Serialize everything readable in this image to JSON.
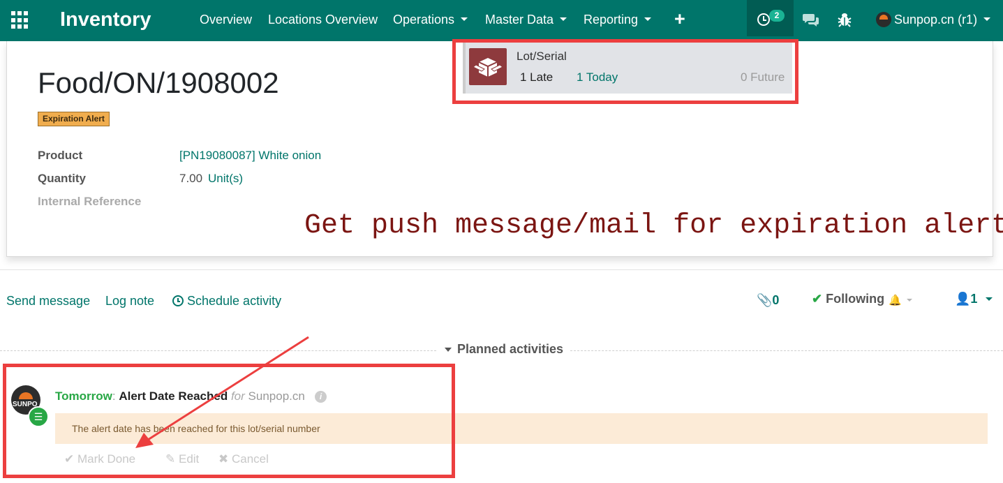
{
  "topbar": {
    "brand": "Inventory",
    "nav_items": [
      "Overview",
      "Locations Overview",
      "Operations",
      "Master Data",
      "Reporting"
    ],
    "activity_count": "2",
    "user_name": "Sunpop.cn (r1)",
    "accent_color": "#00756a"
  },
  "activity_popup": {
    "model_name": "Lot/Serial",
    "late": "1 Late",
    "today": "1 Today",
    "future": "0 Future",
    "icon": "package-icon"
  },
  "record": {
    "title": "Food/ON/1908002",
    "badge": "Expiration Alert",
    "fields": [
      {
        "label": "Product",
        "value": "[PN19080087] White onion"
      },
      {
        "label": "Quantity",
        "value": "7.00",
        "unit": "Unit(s)"
      },
      {
        "label": "Internal Reference",
        "value": ""
      }
    ]
  },
  "annotation": "Get push message/mail for expiration alert.",
  "chatter": {
    "send_message": "Send message",
    "log_note": "Log note",
    "schedule_activity": "Schedule activity",
    "attachments": "0",
    "following": "Following",
    "followers": "1"
  },
  "planned": {
    "heading": "Planned activities",
    "activity": {
      "when": "Tomorrow",
      "separator": ":",
      "summary": "Alert Date Reached",
      "for_word": "for",
      "user": "Sunpop.cn",
      "avatar_text": "SUNPO",
      "note": "The alert date has been reached for this lot/serial number",
      "mark_done": "Mark Done",
      "edit": "Edit",
      "cancel": "Cancel"
    }
  },
  "colors": {
    "highlight_red": "#ec3f3f",
    "annotation_text": "#7b1512"
  }
}
